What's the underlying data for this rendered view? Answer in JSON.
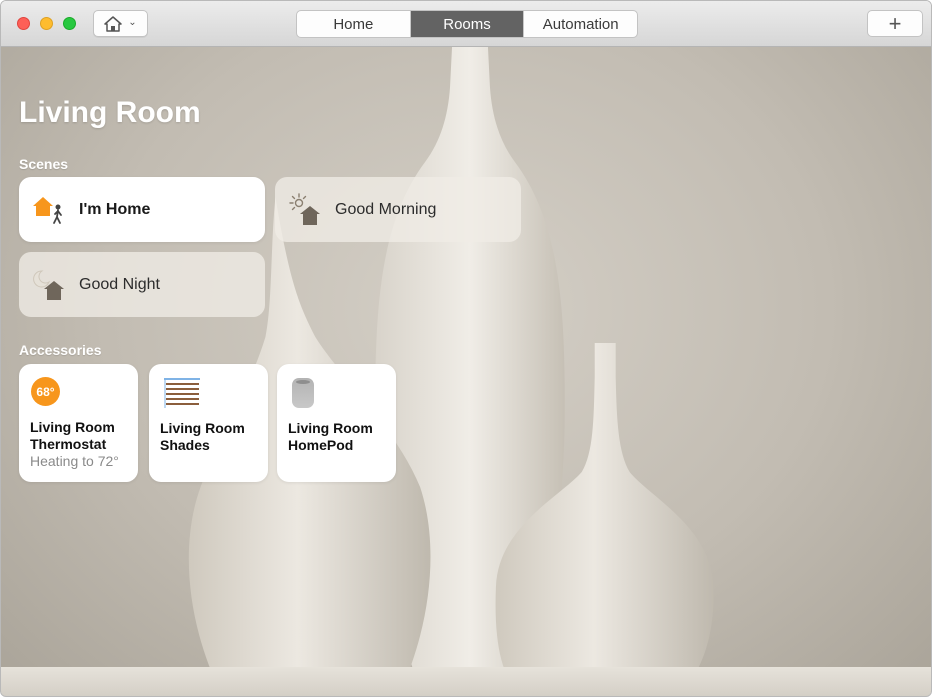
{
  "toolbar": {
    "tabs": [
      {
        "label": "Home",
        "active": false
      },
      {
        "label": "Rooms",
        "active": true
      },
      {
        "label": "Automation",
        "active": false
      }
    ],
    "add_label": "+",
    "home_menu_icon": "house-icon"
  },
  "room": {
    "title": "Living Room"
  },
  "scenes": {
    "label": "Scenes",
    "items": [
      {
        "label": "I'm Home",
        "icon": "arrive-home-icon",
        "active": true
      },
      {
        "label": "Good Morning",
        "icon": "morning-icon",
        "active": false
      },
      {
        "label": "Good Night",
        "icon": "night-icon",
        "active": false
      }
    ]
  },
  "accessories": {
    "label": "Accessories",
    "items": [
      {
        "name_line1": "Living Room",
        "name_line2": "Thermostat",
        "status": "Heating to 72°",
        "badge": "68°",
        "icon": "thermostat-icon"
      },
      {
        "name_line1": "Living Room",
        "name_line2": "Shades",
        "icon": "shades-icon"
      },
      {
        "name_line1": "Living Room",
        "name_line2": "HomePod",
        "icon": "homepod-icon"
      }
    ]
  },
  "colors": {
    "accent_orange": "#f7961c",
    "active_tab": "#636363"
  }
}
